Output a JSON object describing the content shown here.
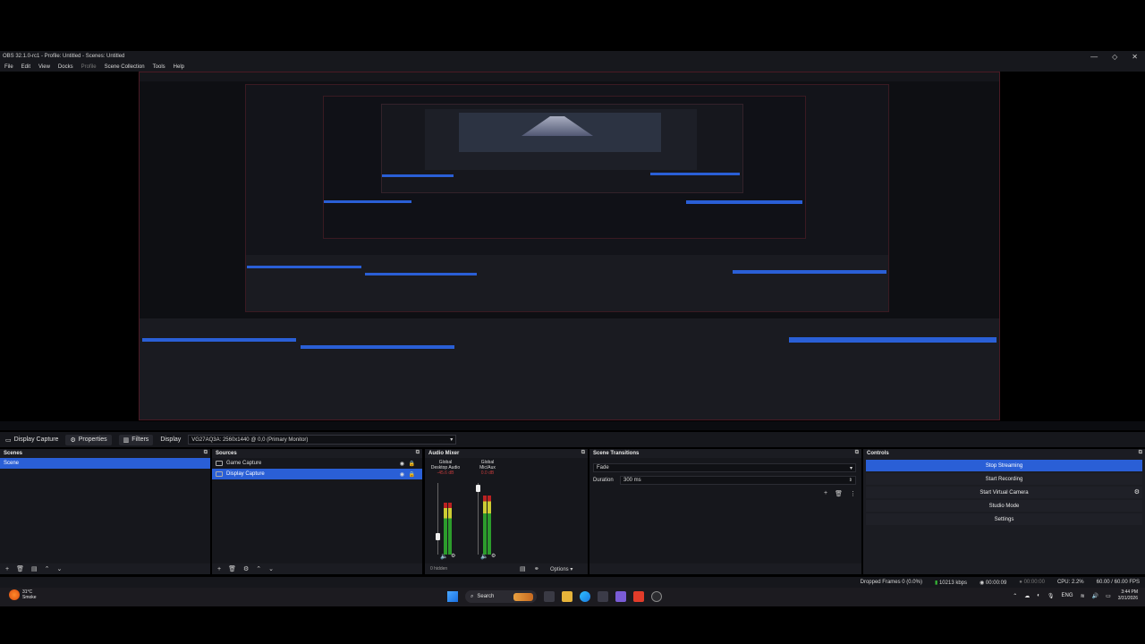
{
  "window": {
    "title": "OBS 32.1.0-rc1 - Profile: Untitled - Scenes: Untitled",
    "minimize": "—",
    "maximize": "◇",
    "close": "✕"
  },
  "menu": [
    "File",
    "Edit",
    "View",
    "Docks",
    "Profile",
    "Scene Collection",
    "Tools",
    "Help"
  ],
  "source_toolbar": {
    "source_name": "Display Capture",
    "properties": "Properties",
    "filters": "Filters",
    "display_label": "Display",
    "display_value": "VG27AQ3A: 2560x1440 @ 0,0 (Primary Monitor)"
  },
  "scenes": {
    "title": "Scenes",
    "items": [
      "Scene"
    ]
  },
  "sources": {
    "title": "Sources",
    "items": [
      "Game Capture",
      "Display Capture"
    ]
  },
  "mixer": {
    "title": "Audio Mixer",
    "channels": [
      {
        "scope": "Global",
        "name": "Desktop Audio",
        "db": "-45.6 dB",
        "level": 0.72,
        "volume": 0.25
      },
      {
        "scope": "Global",
        "name": "Mic/Aux",
        "db": "0.0 dB",
        "level": 0.82,
        "volume": 0.92
      }
    ],
    "ticks": [
      "0",
      "-5",
      "-10",
      "-15",
      "-20",
      "-25",
      "-30",
      "-35",
      "-40",
      "-45",
      "-50",
      "-55",
      "-60"
    ],
    "hidden": "0 hidden",
    "options": "Options"
  },
  "transitions": {
    "title": "Scene Transitions",
    "transition": "Fade",
    "duration_label": "Duration",
    "duration_value": "300 ms"
  },
  "controls": {
    "title": "Controls",
    "buttons": [
      "Stop Streaming",
      "Start Recording",
      "Start Virtual Camera",
      "Studio Mode",
      "Settings"
    ]
  },
  "status": {
    "dropped": "Dropped Frames 0 (0.0%)",
    "bitrate": "10213 kbps",
    "stream_time": "00:00:09",
    "rec_time": "00:00:00",
    "cpu": "CPU: 2.2%",
    "fps": "60.00 / 60.00 FPS"
  },
  "taskbar": {
    "temp": "31°C",
    "weather": "Smoke",
    "search": "Search",
    "lang": "ENG",
    "time": "3:44 PM",
    "date": "3/31/2026"
  },
  "colors": {
    "accent": "#2a5fd6",
    "panel": "#1b1c22",
    "bg": "#16171c"
  }
}
